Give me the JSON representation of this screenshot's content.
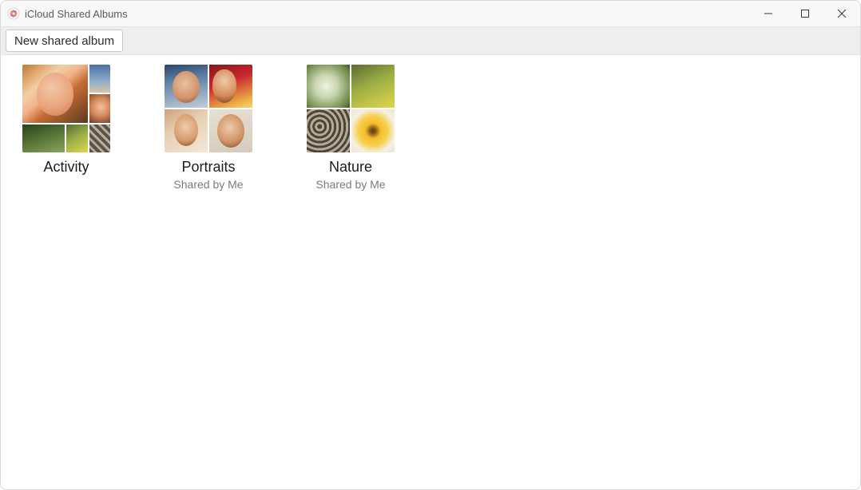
{
  "window": {
    "title": "iCloud Shared Albums"
  },
  "toolbar": {
    "new_album_label": "New shared album"
  },
  "albums": [
    {
      "title": "Activity",
      "subtitle": ""
    },
    {
      "title": "Portraits",
      "subtitle": "Shared by Me"
    },
    {
      "title": "Nature",
      "subtitle": "Shared by Me"
    }
  ]
}
